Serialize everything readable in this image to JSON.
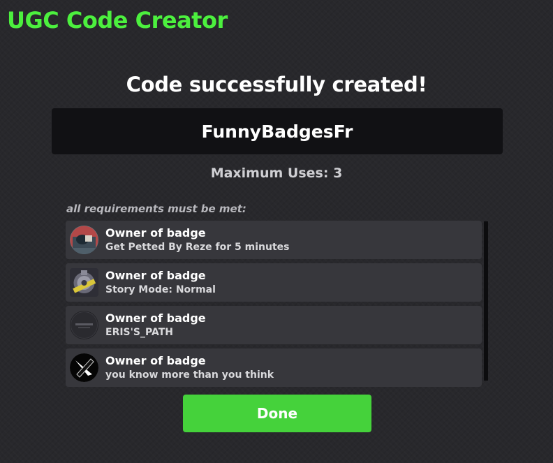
{
  "app": {
    "title": "UGC Code Creator"
  },
  "result": {
    "heading": "Code successfully created!",
    "code": "FunnyBadgesFr",
    "max_uses_label": "Maximum Uses: 3"
  },
  "requirements": {
    "header": "all requirements must be met:",
    "items": [
      {
        "title": "Owner of badge",
        "subtitle": "Get Petted By Reze for 5 minutes",
        "icon": "badge-reze-icon"
      },
      {
        "title": "Owner of badge",
        "subtitle": "Story Mode: Normal",
        "icon": "badge-story-mode-icon"
      },
      {
        "title": "Owner of badge",
        "subtitle": "ERIS'S_PATH",
        "icon": "badge-eris-path-icon"
      },
      {
        "title": "Owner of badge",
        "subtitle": "you know more than you think",
        "icon": "badge-you-know-icon"
      }
    ]
  },
  "actions": {
    "done_label": "Done"
  },
  "colors": {
    "accent_green": "#4cf03e",
    "button_green": "#45d23b",
    "background": "#28282c",
    "code_box": "#111114",
    "row_background": "#37373c"
  }
}
